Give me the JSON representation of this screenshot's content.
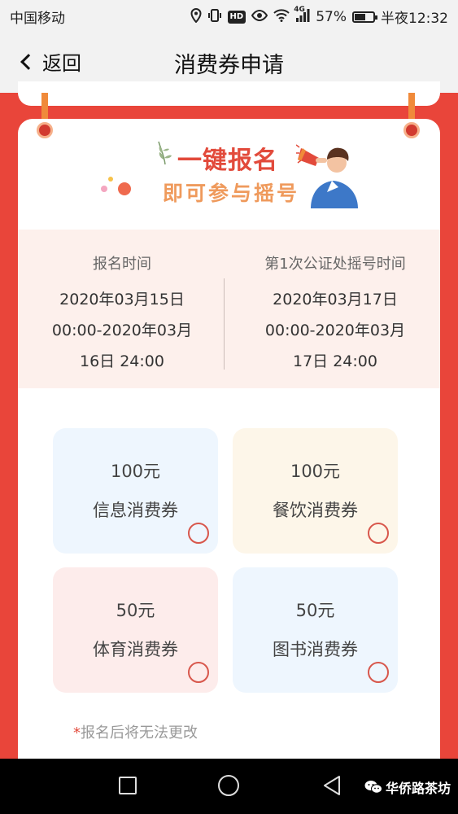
{
  "status_bar": {
    "carrier": "中国移动",
    "battery_text": "57%",
    "battery_level": 0.57,
    "time": "半夜12:32",
    "network_label": "4G",
    "hd_label": "HD"
  },
  "nav": {
    "back_label": "返回",
    "title": "消费券申请"
  },
  "banner": {
    "title": "一键报名",
    "subtitle": "即可参与摇号"
  },
  "times": {
    "signup": {
      "label": "报名时间",
      "lines": [
        "2020年03月15日",
        "00:00-2020年03月",
        "16日 24:00"
      ]
    },
    "lottery": {
      "label": "第1次公证处摇号时间",
      "lines": [
        "2020年03月17日",
        "00:00-2020年03月",
        "17日 24:00"
      ]
    }
  },
  "coupons": [
    {
      "amount": "100元",
      "name": "信息消费券",
      "color": "#eef6fe"
    },
    {
      "amount": "100元",
      "name": "餐饮消费券",
      "color": "#fdf6e9"
    },
    {
      "amount": "50元",
      "name": "体育消费券",
      "color": "#fdeceb"
    },
    {
      "amount": "50元",
      "name": "图书消费券",
      "color": "#eef6fe"
    }
  ],
  "note": {
    "star": "*",
    "text": "报名后将无法更改"
  },
  "watermark": "华侨路茶坊",
  "colors": {
    "accent_red": "#e9453a",
    "title_red": "#e24a3b",
    "subtitle_orange": "#ef9a5c"
  }
}
